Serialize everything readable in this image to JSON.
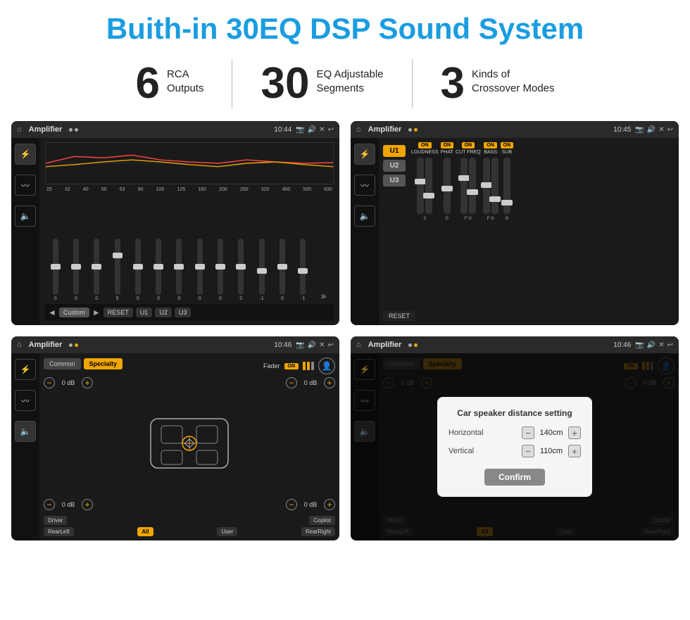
{
  "title": "Buith-in 30EQ DSP Sound System",
  "stats": [
    {
      "number": "6",
      "line1": "RCA",
      "line2": "Outputs"
    },
    {
      "number": "30",
      "line1": "EQ Adjustable",
      "line2": "Segments"
    },
    {
      "number": "3",
      "line1": "Kinds of",
      "line2": "Crossover Modes"
    }
  ],
  "screen1": {
    "status": {
      "title": "Amplifier",
      "time": "10:44"
    },
    "eq_freqs": [
      "25",
      "32",
      "40",
      "50",
      "63",
      "80",
      "100",
      "125",
      "160",
      "200",
      "250",
      "320",
      "400",
      "500",
      "630"
    ],
    "eq_values": [
      "0",
      "0",
      "0",
      "5",
      "0",
      "0",
      "0",
      "0",
      "0",
      "0",
      "-1",
      "0",
      "-1"
    ],
    "preset": "Custom",
    "buttons": [
      "RESET",
      "U1",
      "U2",
      "U3"
    ]
  },
  "screen2": {
    "status": {
      "title": "Amplifier",
      "time": "10:45"
    },
    "u_buttons": [
      "U1",
      "U2",
      "U3"
    ],
    "channels": [
      "LOUDNESS",
      "PHAT",
      "CUT FREQ",
      "BASS",
      "SUB"
    ],
    "channel_on": [
      "ON",
      "ON",
      "ON",
      "ON",
      "ON"
    ],
    "reset": "RESET"
  },
  "screen3": {
    "status": {
      "title": "Amplifier",
      "time": "10:46"
    },
    "tabs": [
      "Common",
      "Specialty"
    ],
    "active_tab": "Specialty",
    "fader_label": "Fader",
    "fader_on": "ON",
    "volumes": [
      "0 dB",
      "0 dB",
      "0 dB",
      "0 dB"
    ],
    "buttons": [
      "Driver",
      "Copilot",
      "RearLeft",
      "All",
      "User",
      "RearRight"
    ]
  },
  "screen4": {
    "status": {
      "title": "Amplifier",
      "time": "10:46"
    },
    "tabs": [
      "Common",
      "Specialty"
    ],
    "active_tab": "Specialty",
    "dialog": {
      "title": "Car speaker distance setting",
      "rows": [
        {
          "label": "Horizontal",
          "value": "140cm"
        },
        {
          "label": "Vertical",
          "value": "110cm"
        }
      ],
      "confirm": "Confirm"
    },
    "volumes": [
      "0 dB",
      "0 dB"
    ],
    "buttons": [
      "Driver",
      "Copilot",
      "RearLeft",
      "All",
      "User",
      "RearRight"
    ]
  }
}
